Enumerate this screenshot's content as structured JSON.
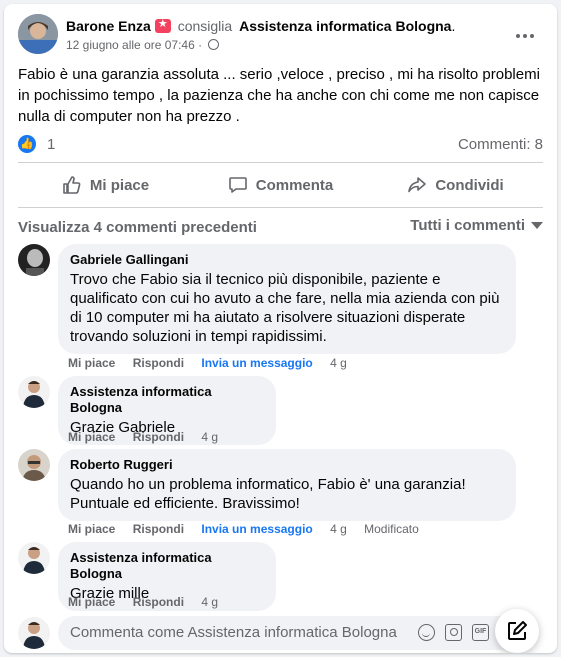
{
  "post": {
    "author": "Barone Enza",
    "verb": "consiglia",
    "page": "Assistenza informatica Bologna",
    "page_suffix": ".",
    "date": "12 giugno alle ore 07:46",
    "date_sep": "·",
    "text": "Fabio è una garanzia assoluta ... serio ,veloce , preciso , mi ha risolto problemi in pochissimo tempo , la pazienza che ha anche con chi come me non capisce nulla di computer non ha prezzo .",
    "reactions_count": "1",
    "comments_count": "Commenti: 8"
  },
  "actions": {
    "like": "Mi piace",
    "comment": "Commenta",
    "share": "Condividi"
  },
  "comments_header": {
    "view_previous": "Visualizza 4 commenti precedenti",
    "filter": "Tutti i commenti"
  },
  "comments": [
    {
      "author": "Gabriele Gallingani",
      "text": "Trovo che Fabio sia il tecnico più disponibile, paziente e qualificato con cui ho avuto a che fare, nella mia azienda con più di 10 computer mi ha aiutato a risolvere situazioni disperate trovando soluzioni in tempi rapidissimi.",
      "like": "Mi piace",
      "reply": "Rispondi",
      "message": "Invia un messaggio",
      "time": "4 g"
    },
    {
      "author": "Assistenza informatica Bologna",
      "text": "Grazie Gabriele",
      "like": "Mi piace",
      "reply": "Rispondi",
      "time": "4 g"
    },
    {
      "author": "Roberto Ruggeri",
      "text": "Quando ho un problema informatico, Fabio è' una garanzia! Puntuale ed efficiente. Bravissimo!",
      "like": "Mi piace",
      "reply": "Rispondi",
      "message": "Invia un messaggio",
      "time": "4 g",
      "edited": "Modificato"
    },
    {
      "author": "Assistenza informatica Bologna",
      "text": "Grazie mille",
      "like": "Mi piace",
      "reply": "Rispondi",
      "time": "4 g"
    }
  ],
  "composer": {
    "placeholder": "Commenta come Assistenza informatica Bologna",
    "gif_label": "GIF"
  },
  "colors": {
    "accent": "#1877f2",
    "secondary_text": "#65676b",
    "bubble": "#f0f2f5",
    "recommend": "#f3425f"
  }
}
